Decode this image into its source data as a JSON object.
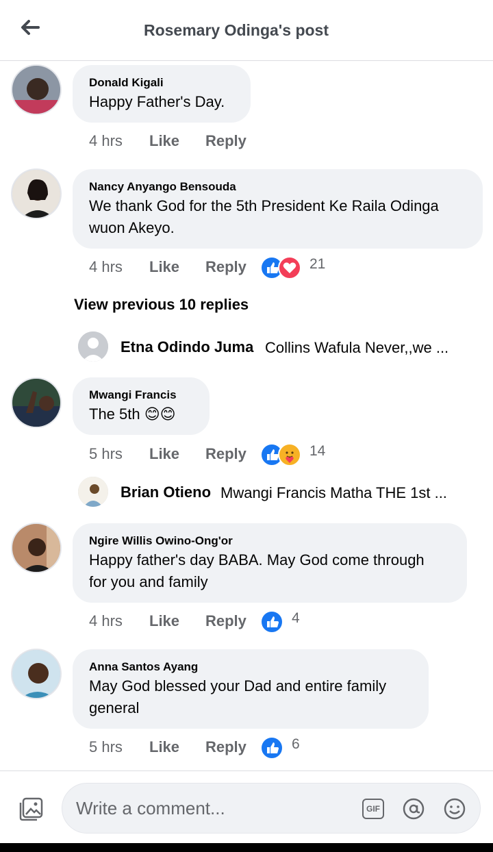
{
  "header": {
    "title": "Rosemary Odinga's post",
    "back_icon": "arrow-left-icon"
  },
  "comments": [
    {
      "author": "Donald Kigali",
      "text": [
        "Happy Father's Day."
      ],
      "time": "4 hrs",
      "like": "Like",
      "reply": "Reply",
      "reactions": [],
      "reaction_count": ""
    },
    {
      "author": "Nancy Anyango Bensouda",
      "text": [
        "We thank God for the 5th President Ke Raila Odinga",
        "wuon Akeyo."
      ],
      "time": "4 hrs",
      "like": "Like",
      "reply": "Reply",
      "reactions": [
        "like",
        "love"
      ],
      "reaction_count": "21"
    },
    {
      "author": "Mwangi Francis",
      "text": [
        "The 5th 😊😊"
      ],
      "time": "5 hrs",
      "like": "Like",
      "reply": "Reply",
      "reactions": [
        "like",
        "care"
      ],
      "reaction_count": "14"
    },
    {
      "author": "Ngire Willis Owino-Ong'or",
      "text": [
        "Happy father's day BABA. May God come through",
        "for you and family"
      ],
      "time": "4 hrs",
      "like": "Like",
      "reply": "Reply",
      "reactions": [
        "like"
      ],
      "reaction_count": "4"
    },
    {
      "author": "Anna Santos Ayang",
      "text": [
        "May God blessed your Dad and entire family",
        "general"
      ],
      "time": "5 hrs",
      "like": "Like",
      "reply": "Reply",
      "reactions": [
        "like"
      ],
      "reaction_count": "6"
    }
  ],
  "view_previous": "View previous 10 replies",
  "replies": [
    {
      "name": "Etna Odindo Juma",
      "text": "Collins Wafula Never,,we ..."
    },
    {
      "name": "Brian Otieno",
      "text": "Mwangi Francis Matha THE 1st ..."
    }
  ],
  "composer": {
    "placeholder": "Write a comment...",
    "gif_label": "GIF",
    "photo_icon": "photo-icon",
    "at_icon": "mention-icon",
    "emoji_icon": "emoji-icon"
  },
  "colors": {
    "like": "#1877f2",
    "love": "#f33e58",
    "care": "#f7b125",
    "bubble": "#f0f2f5",
    "meta": "#65676b"
  }
}
